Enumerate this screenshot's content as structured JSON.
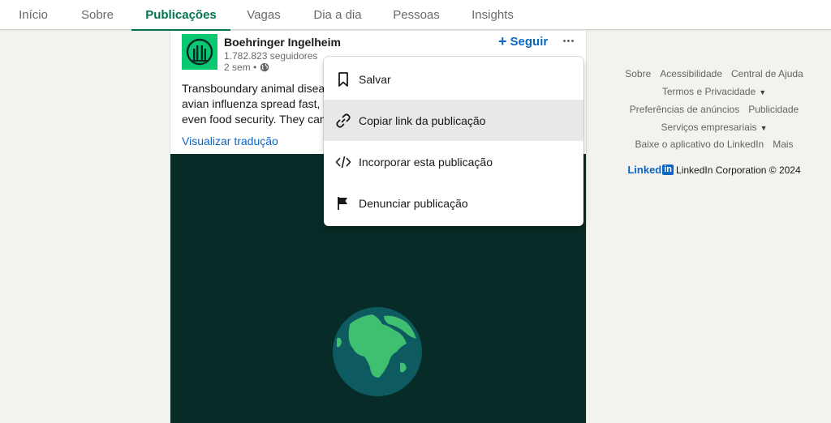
{
  "tabs": [
    {
      "label": "Início"
    },
    {
      "label": "Sobre"
    },
    {
      "label": "Publicações",
      "active": true
    },
    {
      "label": "Vagas"
    },
    {
      "label": "Dia a dia"
    },
    {
      "label": "Pessoas"
    },
    {
      "label": "Insights"
    }
  ],
  "post": {
    "company": "Boehringer Ingelheim",
    "followers": "1.782.823 seguidores",
    "time": "2 sem •",
    "follow_label": "Seguir",
    "follow_plus": "+",
    "text_lines": [
      "Transboundary animal diseases",
      "avian influenza spread fast, quic",
      "even food security. They can cau"
    ],
    "translate_label": "Visualizar tradução"
  },
  "menu": {
    "items": [
      {
        "label": "Salvar",
        "icon": "bookmark-icon"
      },
      {
        "label": "Copiar link da publicação",
        "icon": "link-icon",
        "hovered": true
      },
      {
        "label": "Incorporar esta publicação",
        "icon": "code-icon"
      },
      {
        "label": "Denunciar publicação",
        "icon": "flag-icon"
      }
    ]
  },
  "footer": {
    "row1": [
      "Sobre",
      "Acessibilidade",
      "Central de Ajuda"
    ],
    "row2": "Termos e Privacidade",
    "row3": [
      "Preferências de anúncios",
      "Publicidade"
    ],
    "row4": "Serviços empresariais",
    "row5": [
      "Baixe o aplicativo do LinkedIn",
      "Mais"
    ],
    "brand_word": "Linked",
    "brand_box": "in",
    "copyright": "LinkedIn Corporation © 2024"
  },
  "colors": {
    "accent_green": "#01754f",
    "link_blue": "#0a66c2",
    "logo_green": "#08c971",
    "media_bg": "#072b26"
  }
}
